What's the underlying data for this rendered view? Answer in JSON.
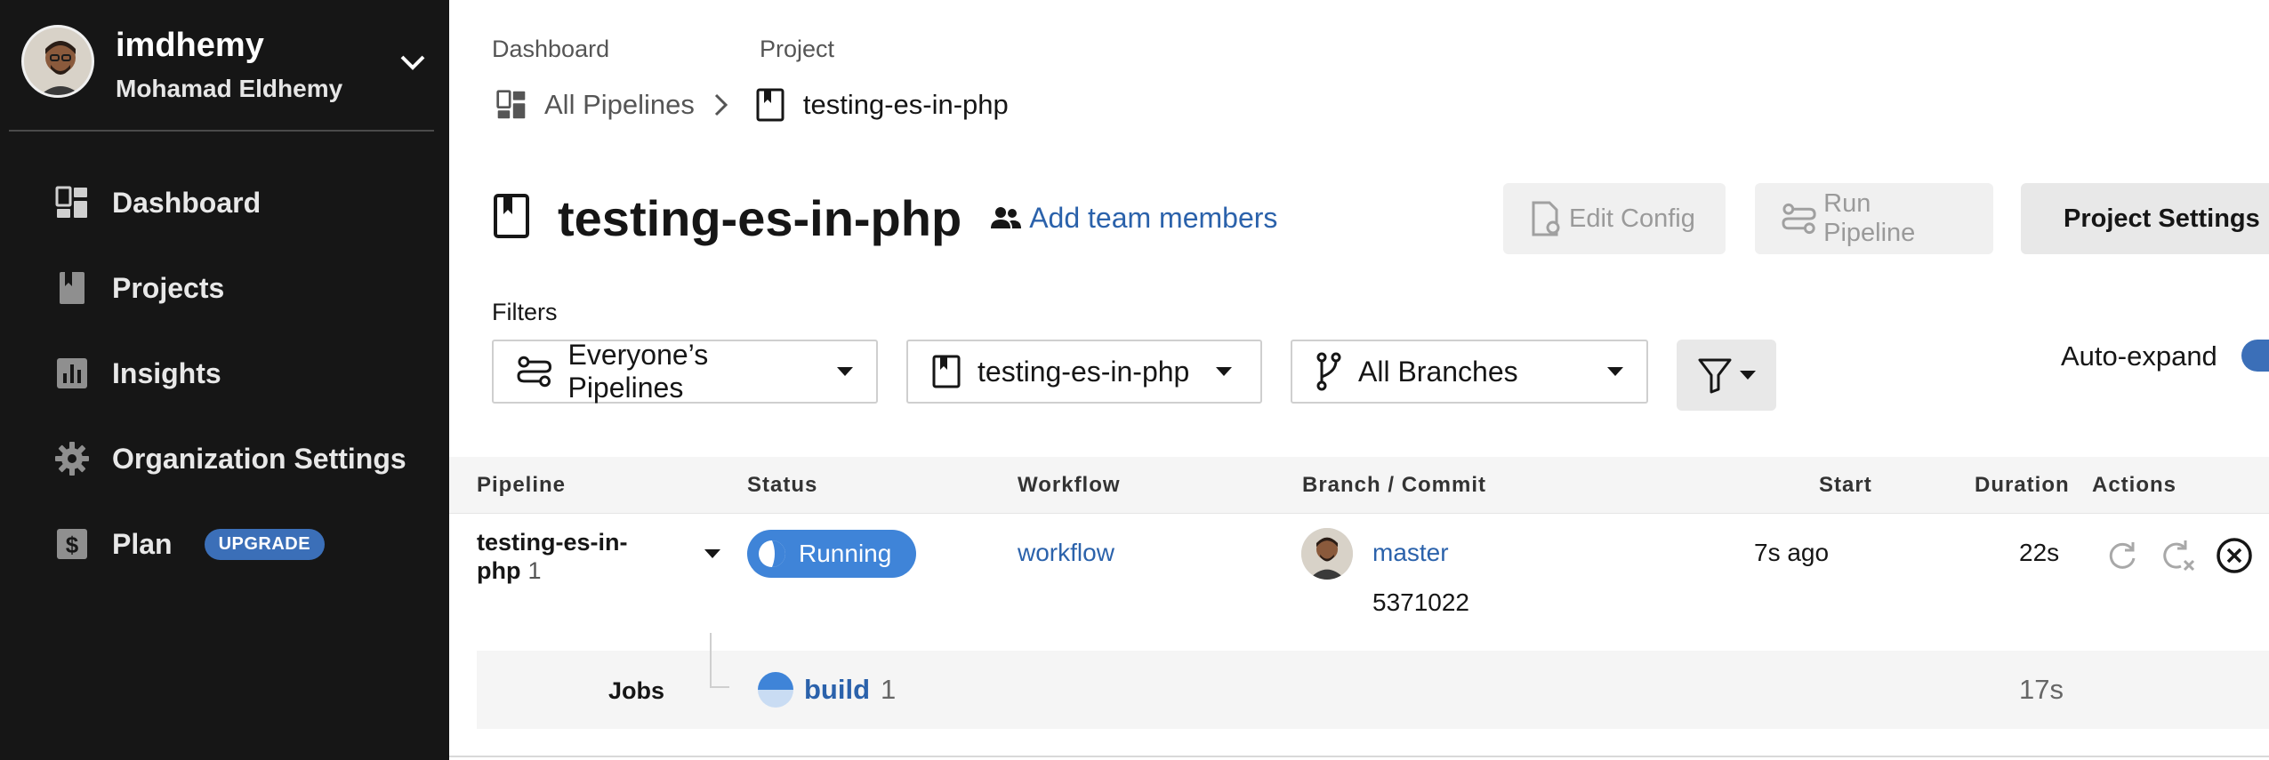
{
  "user": {
    "username": "imdhemy",
    "full_name": "Mohamad Eldhemy"
  },
  "sidebar": {
    "items": [
      {
        "label": "Dashboard",
        "icon": "dashboard-icon"
      },
      {
        "label": "Projects",
        "icon": "bookmark-icon"
      },
      {
        "label": "Insights",
        "icon": "bar-chart-icon"
      },
      {
        "label": "Organization Settings",
        "icon": "gear-icon"
      },
      {
        "label": "Plan",
        "icon": "dollar-icon",
        "badge": "UPGRADE"
      }
    ]
  },
  "breadcrumb": {
    "dashboard_label": "Dashboard",
    "project_label": "Project",
    "all_pipelines": "All Pipelines",
    "project_name": "testing-es-in-php"
  },
  "header": {
    "title": "testing-es-in-php",
    "add_team": "Add team members",
    "edit_config": "Edit Config",
    "run_pipeline": "Run Pipeline",
    "project_settings": "Project Settings"
  },
  "filters": {
    "label": "Filters",
    "pipelines": "Everyone’s Pipelines",
    "project": "testing-es-in-php",
    "branches": "All Branches",
    "auto_expand": "Auto-expand"
  },
  "table": {
    "headers": {
      "pipeline": "Pipeline",
      "status": "Status",
      "workflow": "Workflow",
      "branch": "Branch / Commit",
      "start": "Start",
      "duration": "Duration",
      "actions": "Actions"
    },
    "row": {
      "pipeline_name": "testing-es-in-php",
      "pipeline_number": "1",
      "status": "Running",
      "workflow": "workflow",
      "branch": "master",
      "commit": "5371022",
      "start": "7s ago",
      "duration": "22s"
    },
    "jobs": {
      "label": "Jobs",
      "name": "build",
      "number": "1",
      "duration": "17s"
    }
  },
  "colors": {
    "sidebar_bg": "#161616",
    "accent_blue": "#2b62ab",
    "running_blue": "#3f84d8",
    "badge_blue": "#3b6fb8"
  }
}
